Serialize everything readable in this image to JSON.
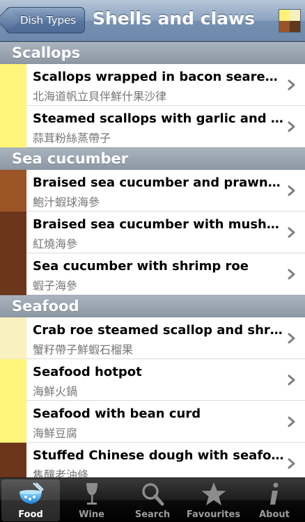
{
  "navbar": {
    "back_label": "Dish Types",
    "title": "Shells and claws",
    "swatch_colors": [
      "#fff178",
      "#f5f0c0",
      "#99542a",
      "#5f3a1e"
    ]
  },
  "sections": [
    {
      "title": "Scallops",
      "rows": [
        {
          "name": "Scallops wrapped in bacon seared with fruit salad",
          "cname": "北海道帆立貝伴鮮什果沙律",
          "color": "#fef57a"
        },
        {
          "name": "Steamed scallops with garlic and vermicelli",
          "cname": "蒜茸粉絲蒸帶子",
          "color": "#fef57a"
        }
      ]
    },
    {
      "title": "Sea cucumber",
      "rows": [
        {
          "name": "Braised sea cucumber and prawns in abalone sauce",
          "cname": "鮑汁蝦球海參",
          "color": "#9c5526"
        },
        {
          "name": "Braised sea cucumber with mushrooms",
          "cname": "紅燒海參",
          "color": "#6c361c"
        },
        {
          "name": "Sea cucumber with shrimp roe",
          "cname": "蝦子海參",
          "color": "#6c361c"
        }
      ]
    },
    {
      "title": "Seafood",
      "rows": [
        {
          "name": "Crab roe steamed scallop and shrimp",
          "cname": "蟹籽帶子鮮蝦石榴果",
          "color": "#f9f1c0"
        },
        {
          "name": "Seafood hotpot",
          "cname": "海鮮火鍋",
          "color": "#fef57a"
        },
        {
          "name": "Seafood with bean curd",
          "cname": "海鮮豆腐",
          "color": "#fef57a"
        },
        {
          "name": "Stuffed Chinese dough with seafood",
          "cname": "雋釀老油條",
          "color": "#6c361c"
        }
      ]
    }
  ],
  "tabs": [
    {
      "label": "Food",
      "icon": "bowl-icon",
      "selected": true
    },
    {
      "label": "Wine",
      "icon": "wine-glass-icon",
      "selected": false
    },
    {
      "label": "Search",
      "icon": "magnifier-icon",
      "selected": false
    },
    {
      "label": "Favourites",
      "icon": "star-icon",
      "selected": false
    },
    {
      "label": "About",
      "icon": "info-icon",
      "selected": false
    }
  ]
}
